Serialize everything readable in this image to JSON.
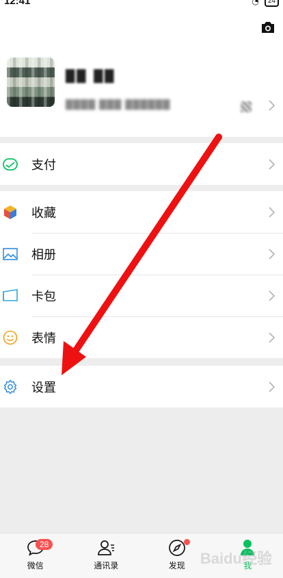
{
  "status_bar": {
    "time": "12:41",
    "battery": "24"
  },
  "profile": {
    "nickname": "██ ██",
    "wechat_id": "████ ███ ██████"
  },
  "menu": {
    "pay": "支付",
    "favorites": "收藏",
    "album": "相册",
    "cards": "卡包",
    "stickers": "表情",
    "settings": "设置"
  },
  "tabbar": {
    "chats": "微信",
    "chats_badge": "28",
    "contacts": "通讯录",
    "discover": "发现",
    "me": "我"
  },
  "watermark": "Baidu经验",
  "colors": {
    "accent": "#07c160",
    "badge": "#fa5151",
    "arrow": "#ee1111"
  }
}
